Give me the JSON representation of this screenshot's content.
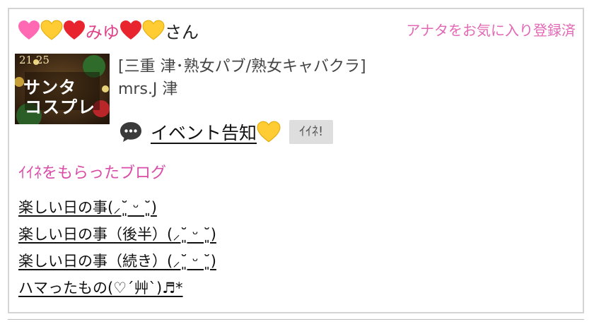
{
  "colors": {
    "pink_heart": "#ff69b4",
    "yellow_heart": "#ffcc33",
    "red_heart": "#e8252f",
    "accent_pink": "#e268b6",
    "section_pink": "#d94ca8",
    "border": "#d4d4d4",
    "like_button_bg": "#dedede"
  },
  "header": {
    "user_name_parts": [
      "みゆ",
      "さん"
    ],
    "user_name_hearts": [
      "pink-heart-icon",
      "yellow-heart-icon",
      "red-heart-icon",
      "red-heart-icon",
      "yellow-heart-icon"
    ],
    "favorite_status": "アナタをお気に入り登録済"
  },
  "post": {
    "thumbnail": {
      "date_text": "21.25",
      "caption_line1": "サンタ",
      "caption_line2": "コスプレ"
    },
    "shop_category": "[三重 津･熟女パブ/熟女キャバクラ]",
    "shop_name": "mrs.J 津",
    "title": "イベント告知",
    "title_icon": "yellow-heart-icon",
    "like_label": "ｲｲﾈ!"
  },
  "liked_blogs": {
    "heading": "ｲｲﾈをもらったブログ",
    "items": [
      "楽しい日の事(⸝˘͈ ᵕ ˘͈)",
      "楽しい日の事（後半）(⸝˘͈ ᵕ ˘͈)",
      "楽しい日の事（続き）(⸝˘͈ ᵕ ˘͈)",
      "ハマったもの(♡´艸`)♬*"
    ]
  }
}
